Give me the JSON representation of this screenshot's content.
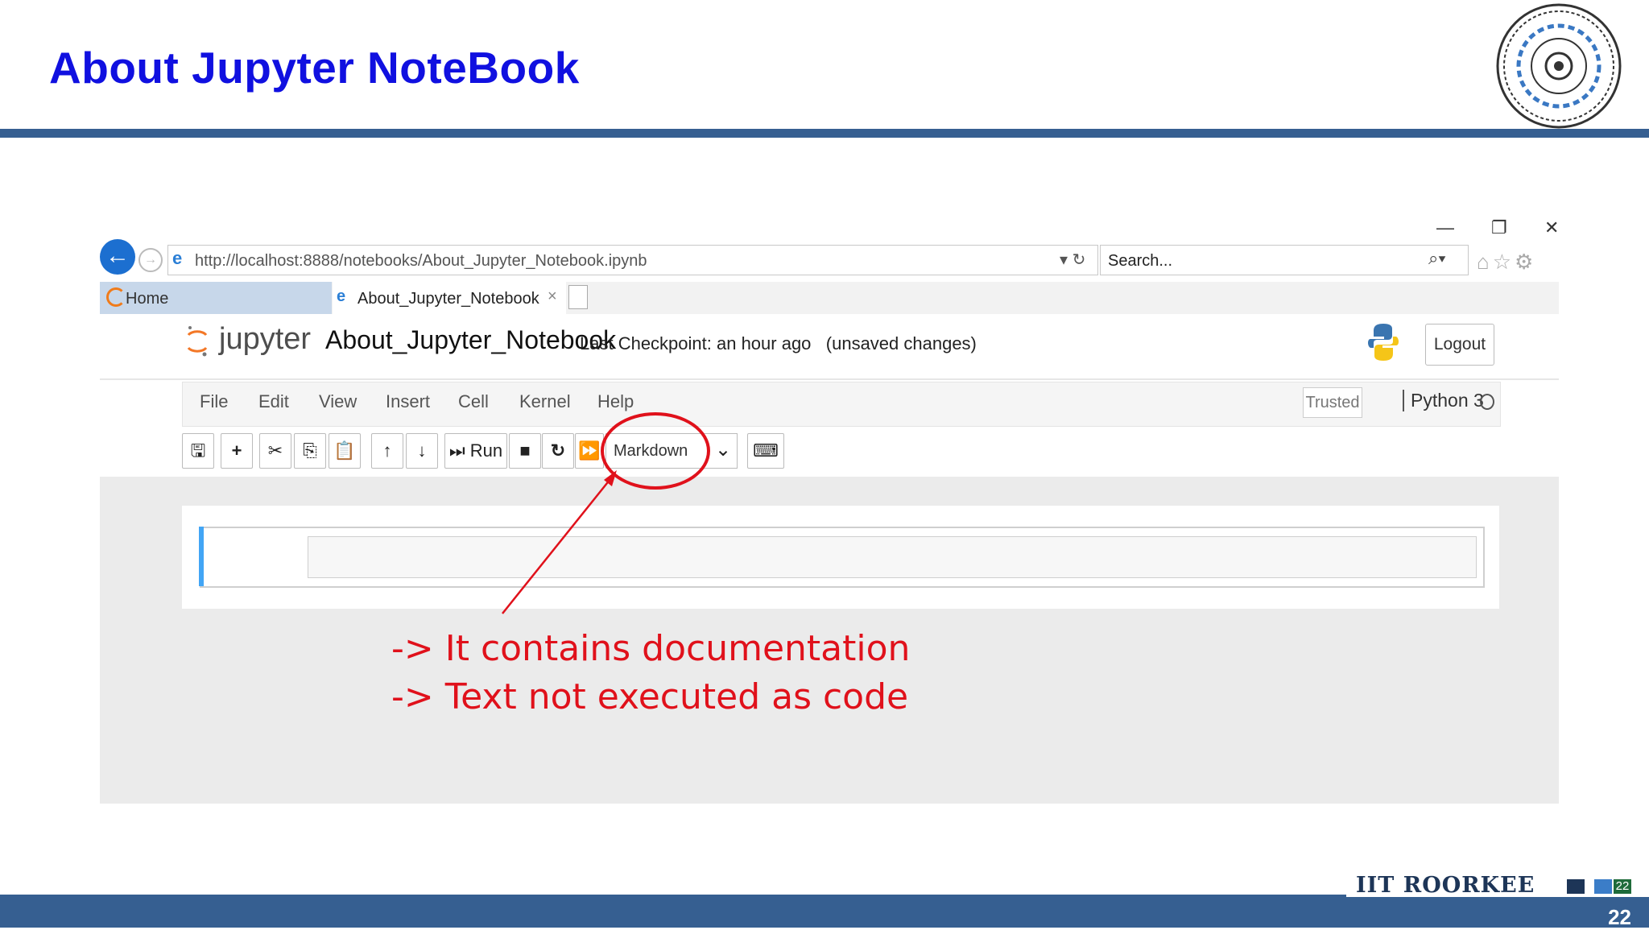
{
  "slide": {
    "title": "About Jupyter NoteBook",
    "page_number": "22",
    "brand": "IIT ROORKEE",
    "brand_small": "22",
    "colors": {
      "title": "#1010e0",
      "rule": "#365f91",
      "annotation": "#e0111b"
    }
  },
  "browser": {
    "url": "http://localhost:8888/notebooks/About_Jupyter_Notebook.ipynb",
    "search_placeholder": "Search...",
    "tabs": [
      {
        "label": "Home",
        "active": false
      },
      {
        "label": "About_Jupyter_Notebook",
        "active": true
      }
    ],
    "tab_close": "×"
  },
  "jupyter": {
    "logo_text": "jupyter",
    "notebook_name": "About_Jupyter_Notebook",
    "checkpoint": "Last Checkpoint: an hour ago",
    "unsaved": "(unsaved changes)",
    "logout": "Logout",
    "menu": [
      "File",
      "Edit",
      "View",
      "Insert",
      "Cell",
      "Kernel",
      "Help"
    ],
    "trusted": "Trusted",
    "kernel": "Python 3",
    "toolbar": {
      "run": "Run"
    },
    "cell_type": "Markdown"
  },
  "annotations": [
    "-> It contains documentation",
    "-> Text not executed as code"
  ]
}
